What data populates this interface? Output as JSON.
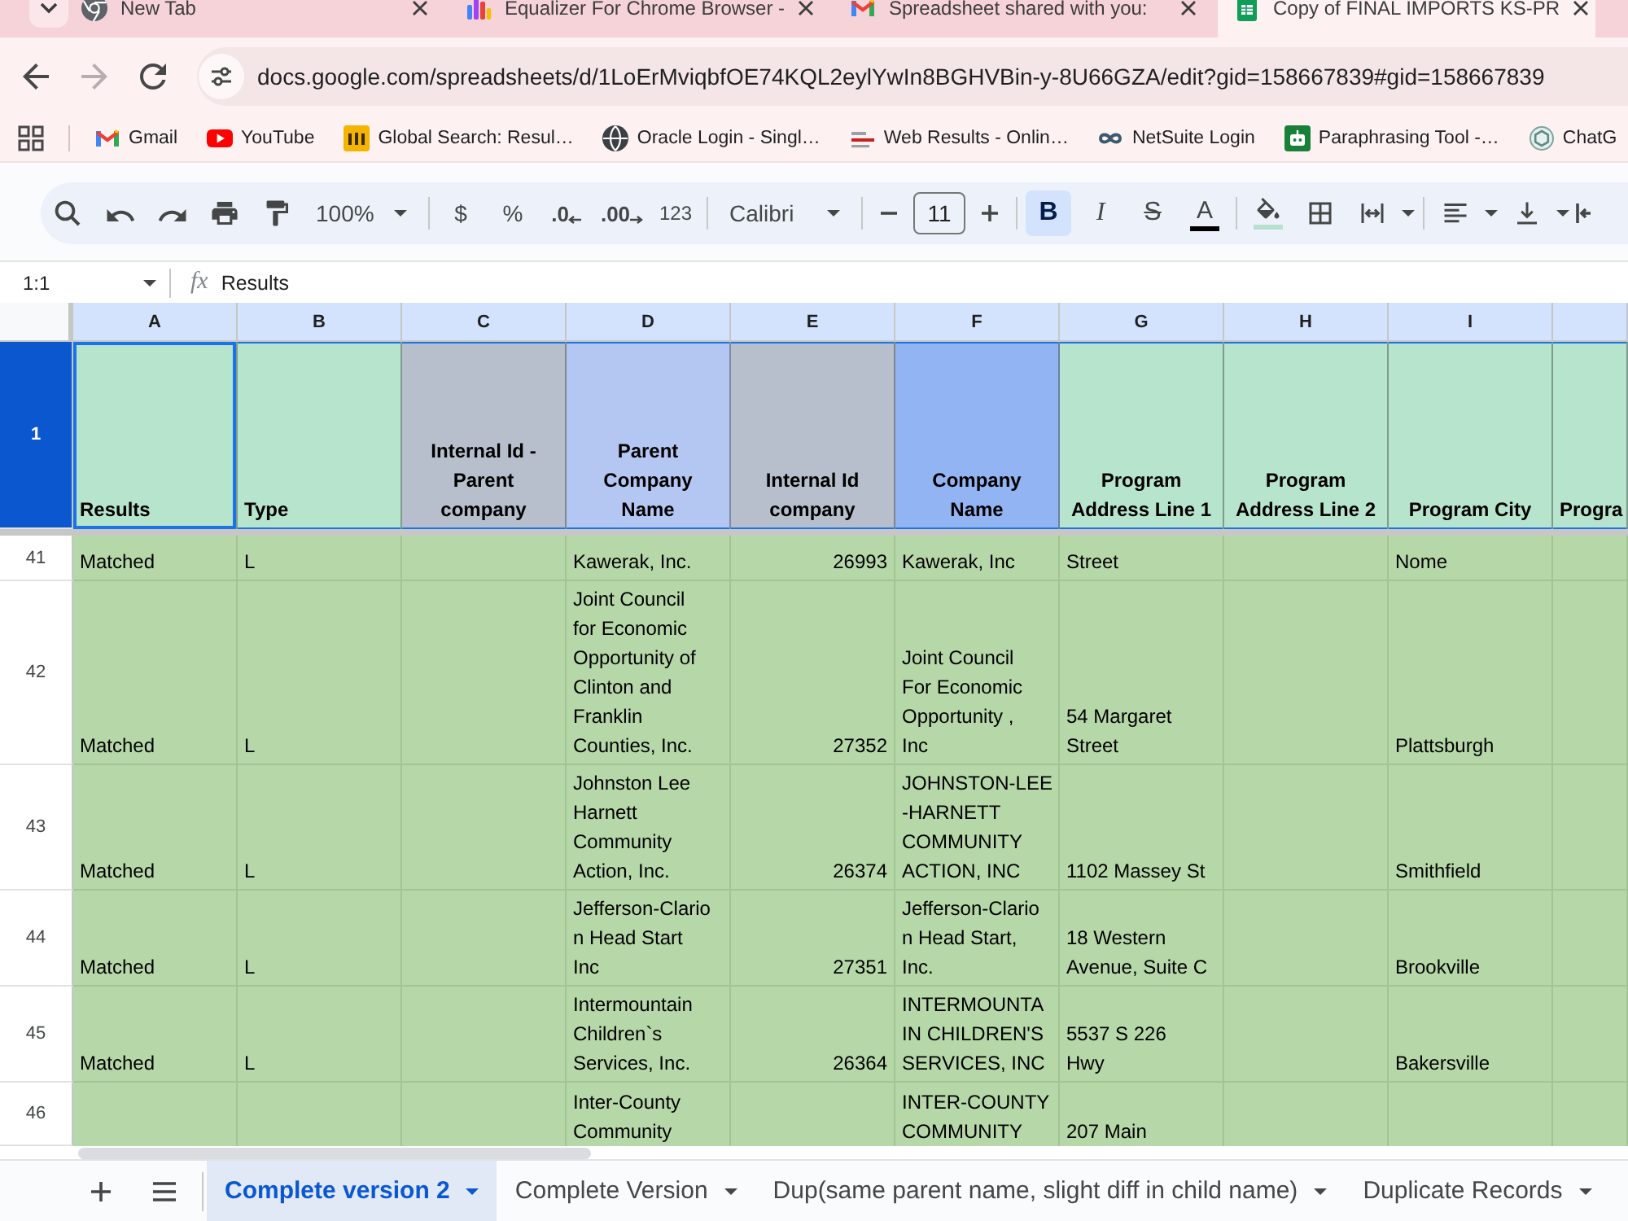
{
  "browser": {
    "tabs": [
      {
        "title": "New Tab",
        "selected": false
      },
      {
        "title": "Equalizer For Chrome Browser -",
        "selected": false
      },
      {
        "title": "Spreadsheet shared with you:",
        "selected": false
      },
      {
        "title": "Copy of FINAL IMPORTS KS-PR",
        "selected": true
      }
    ],
    "nav_buttons": [
      {
        "kind": "back",
        "disabled": false
      },
      {
        "kind": "forward",
        "disabled": true
      },
      {
        "kind": "reload",
        "disabled": false
      }
    ],
    "url": "docs.google.com/spreadsheets/d/1LoErMviqbfOE74KQL2eylYwIn8BGHVBin-y-8U66GZA/edit?gid=158667839#gid=158667839",
    "bookmarks": [
      {
        "label": "Gmail"
      },
      {
        "label": "YouTube"
      },
      {
        "label": "Global Search: Resul…"
      },
      {
        "label": "Oracle Login - Singl…"
      },
      {
        "label": "Web Results - Onlin…"
      },
      {
        "label": "NetSuite Login"
      },
      {
        "label": "Paraphrasing Tool -…"
      },
      {
        "label": "ChatG"
      }
    ]
  },
  "toolbar": {
    "zoom": "100%",
    "currency": "$",
    "percent": "%",
    "decrease_decimals": ".0",
    "increase_decimals": ".00",
    "number_format": "123",
    "font": "Calibri",
    "font_size": "11",
    "bold": {
      "label": "B",
      "on": true
    },
    "italic": {
      "label": "I",
      "on": false
    },
    "strikethrough": "S",
    "text_color": {
      "label": "A",
      "color": "#000000"
    },
    "fill_color": {
      "color": "#b7e1cd"
    }
  },
  "formula_bar": {
    "name_box": "1:1",
    "fx": "fx",
    "content": "Results"
  },
  "sheet": {
    "columns": [
      {
        "letter": "A",
        "kind": "text"
      },
      {
        "letter": "B",
        "kind": "text"
      },
      {
        "letter": "C",
        "kind": "number"
      },
      {
        "letter": "D",
        "kind": "text"
      },
      {
        "letter": "E",
        "kind": "number"
      },
      {
        "letter": "F",
        "kind": "text"
      },
      {
        "letter": "G",
        "kind": "text"
      },
      {
        "letter": "H",
        "kind": "text"
      },
      {
        "letter": "I",
        "kind": "text"
      }
    ],
    "header_row": {
      "number": "1",
      "selected": true,
      "cells": [
        {
          "text": "Results",
          "color": "#b7e4cd",
          "kind": "left"
        },
        {
          "text": "Type",
          "color": "#b7e4cd",
          "kind": "left"
        },
        {
          "text": "Internal Id -\nParent\ncompany",
          "color": "#b7bfcc",
          "kind": "center"
        },
        {
          "text": "Parent\nCompany\nName",
          "color": "#b4c7f3",
          "kind": "center"
        },
        {
          "text": "Internal Id\ncompany",
          "color": "#b7bfcc",
          "kind": "center"
        },
        {
          "text": "Company\nName",
          "color": "#93b4f2",
          "kind": "center"
        },
        {
          "text": "Program\nAddress Line 1",
          "color": "#b7e4cd",
          "kind": "center"
        },
        {
          "text": "Program\nAddress Line 2",
          "color": "#b7e4cd",
          "kind": "center"
        },
        {
          "text": "Program City",
          "color": "#b7e4cd",
          "kind": "center"
        },
        {
          "text": "Progra",
          "color": "#b7e4cd",
          "kind": "left"
        }
      ]
    },
    "rows": [
      {
        "number": "41",
        "selected": false,
        "cells": [
          "Matched",
          "L",
          null,
          "Kawerak, Inc.",
          "26993",
          "Kawerak, Inc",
          "Street",
          null,
          "Nome",
          null
        ]
      },
      {
        "number": "42",
        "selected": false,
        "cells": [
          "Matched",
          "L",
          null,
          "Joint Council\nfor Economic\nOpportunity of\nClinton and\nFranklin\nCounties, Inc.",
          "27352",
          "Joint Council\nFor Economic\nOpportunity ,\nInc",
          "54 Margaret\nStreet",
          null,
          "Plattsburgh",
          null
        ]
      },
      {
        "number": "43",
        "selected": false,
        "cells": [
          "Matched",
          "L",
          null,
          "Johnston Lee\nHarnett\nCommunity\nAction, Inc.",
          "26374",
          "JOHNSTON-LEE\n-HARNETT\nCOMMUNITY\nACTION, INC",
          "1102 Massey St",
          null,
          "Smithfield",
          null
        ]
      },
      {
        "number": "44",
        "selected": false,
        "cells": [
          "Matched",
          "L",
          null,
          "Jefferson-Clario\nn Head Start\nInc",
          "27351",
          "Jefferson-Clario\nn Head Start,\nInc.",
          "18 Western\nAvenue, Suite C",
          null,
          "Brookville",
          null
        ]
      },
      {
        "number": "45",
        "selected": false,
        "cells": [
          "Matched",
          "L",
          null,
          "Intermountain\nChildren`s\nServices, Inc.",
          "26364",
          "INTERMOUNTA\nIN CHILDREN'S\nSERVICES, INC",
          "5537 S 226\nHwy",
          null,
          "Bakersville",
          null
        ]
      },
      {
        "number": "46",
        "selected": false,
        "cells": [
          null,
          null,
          null,
          "Inter-County\nCommunity",
          null,
          "INTER-COUNTY\nCOMMUNITY",
          "207 Main",
          null,
          null,
          null
        ]
      }
    ]
  },
  "sheet_tabs": [
    {
      "name": "Complete version 2",
      "selected": true
    },
    {
      "name": "Complete Version",
      "selected": false
    },
    {
      "name": "Dup(same parent name, slight diff in child name)",
      "selected": false
    },
    {
      "name": "Duplicate Records",
      "selected": false
    }
  ]
}
